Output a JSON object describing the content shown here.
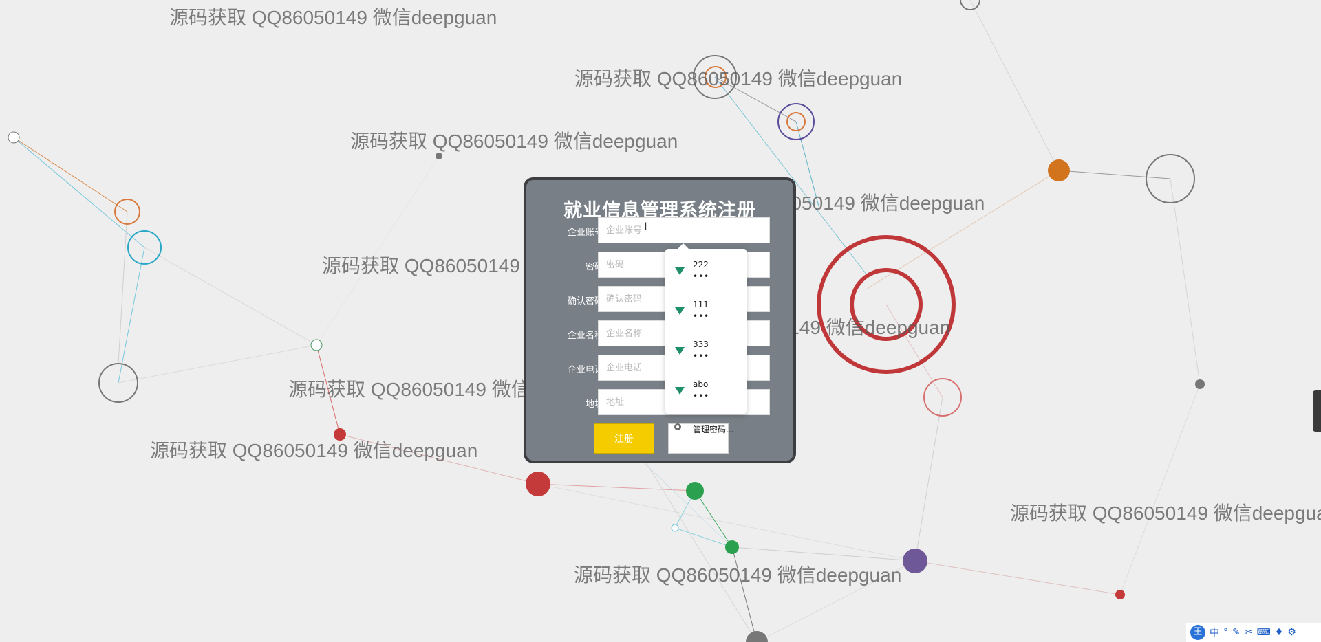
{
  "form": {
    "title": "就业信息管理系统注册",
    "fields": [
      {
        "label": "企业账号",
        "placeholder": "企业账号",
        "value": ""
      },
      {
        "label": "密码",
        "placeholder": "密码",
        "value": ""
      },
      {
        "label": "确认密码",
        "placeholder": "确认密码",
        "value": ""
      },
      {
        "label": "企业名称",
        "placeholder": "企业名称",
        "value": ""
      },
      {
        "label": "企业电话",
        "placeholder": "企业电话",
        "value": ""
      },
      {
        "label": "地址",
        "placeholder": "地址",
        "value": ""
      }
    ],
    "register_label": "注册"
  },
  "autocomplete": {
    "items": [
      {
        "username": "222",
        "password": "•••"
      },
      {
        "username": "111",
        "password": "•••"
      },
      {
        "username": "333",
        "password": "•••"
      },
      {
        "username": "abo",
        "password": "•••"
      }
    ],
    "manage_label": "管理密码..."
  },
  "watermark_text": "源码获取 QQ86050149 微信deepguan",
  "ime": {
    "logo": "王",
    "items": [
      "中",
      "°",
      "✎",
      "✂",
      "⌨",
      "♦",
      "⚙"
    ]
  },
  "colors": {
    "panel": "#787f86",
    "register_button": "#f5cc00",
    "keyicon": "#1f8f6a"
  }
}
